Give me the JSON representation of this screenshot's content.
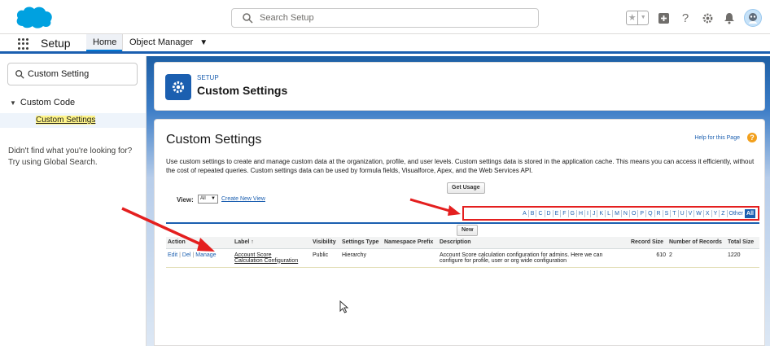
{
  "header": {
    "search_placeholder": "Search Setup"
  },
  "nav": {
    "app_name": "Setup",
    "tabs": [
      {
        "label": "Home"
      },
      {
        "label": "Object Manager"
      }
    ]
  },
  "sidebar": {
    "quick_find_value": "Custom Setting",
    "tree_parent": "Custom Code",
    "tree_child": "Custom Settings",
    "not_found_line1": "Didn't find what you're looking for?",
    "not_found_line2": "Try using Global Search."
  },
  "setup_header": {
    "eyebrow": "SETUP",
    "title": "Custom Settings"
  },
  "content": {
    "title": "Custom Settings",
    "help_link": "Help for this Page",
    "description": "Use custom settings to create and manage custom data at the organization, profile, and user levels. Custom settings data is stored in the application cache. This means you can access it efficiently, without the cost of repeated queries. Custom settings data can be used by formula fields, Visualforce, Apex, and the Web Services API.",
    "get_usage_label": "Get Usage",
    "view_label": "View:",
    "view_selected": "All",
    "create_view_link": "Create New View",
    "new_button_label": "New",
    "alphabet": [
      "A",
      "B",
      "C",
      "D",
      "E",
      "F",
      "G",
      "H",
      "I",
      "J",
      "K",
      "L",
      "M",
      "N",
      "O",
      "P",
      "Q",
      "R",
      "S",
      "T",
      "U",
      "V",
      "W",
      "X",
      "Y",
      "Z",
      "Other",
      "All"
    ],
    "alphabet_active": "All"
  },
  "table": {
    "columns": {
      "action": "Action",
      "label": "Label ↑",
      "visibility": "Visibility",
      "settings_type": "Settings Type",
      "namespace_prefix": "Namespace Prefix",
      "description": "Description",
      "record_size": "Record Size",
      "number_of_records": "Number of Records",
      "total_size": "Total Size"
    },
    "rows": [
      {
        "action_edit": "Edit",
        "action_del": "Del",
        "action_manage": "Manage",
        "label_line1": "Account Score",
        "label_line2": "Calculation Configuration",
        "visibility": "Public",
        "settings_type": "Hierarchy",
        "namespace_prefix": "",
        "description": "Account Score calculation configuration for admins. Here we can configure for profile, user or org wide configuration",
        "record_size": "610",
        "number_of_records": "2",
        "total_size": "1220"
      }
    ]
  },
  "colors": {
    "brand_blue": "#1b5fb0",
    "salesforce_cloud": "#00a1e0",
    "annotation_red": "#e41f1f",
    "highlight_yellow": "#fff58a"
  }
}
